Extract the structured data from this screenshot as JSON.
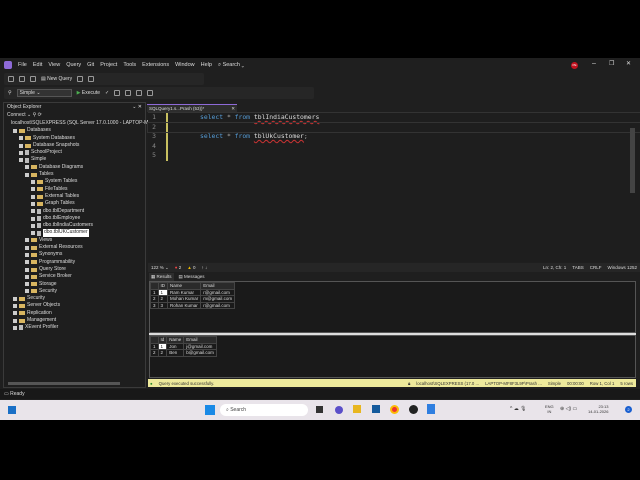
{
  "menu": [
    "File",
    "Edit",
    "View",
    "Query",
    "Git",
    "Project",
    "Tools",
    "Extensions",
    "Window",
    "Help"
  ],
  "search_label": "Search",
  "toolbar": {
    "new_query": "New Query",
    "database": "Simple",
    "execute": "Execute"
  },
  "avatar": "PE",
  "object_explorer": {
    "title": "Object Explorer",
    "connect": "Connect",
    "items": [
      {
        "label": "localhost\\SQLEXPRESS (SQL Server 17.0.1000 - LAPTOP-M",
        "level": 0,
        "type": "server"
      },
      {
        "label": "Databases",
        "level": 1,
        "type": "folder"
      },
      {
        "label": "System Databases",
        "level": 2,
        "type": "folder"
      },
      {
        "label": "Database Snapshots",
        "level": 2,
        "type": "folder"
      },
      {
        "label": "SchoolProject",
        "level": 2,
        "type": "db"
      },
      {
        "label": "Simple",
        "level": 2,
        "type": "db"
      },
      {
        "label": "Database Diagrams",
        "level": 3,
        "type": "folder"
      },
      {
        "label": "Tables",
        "level": 3,
        "type": "folder"
      },
      {
        "label": "System Tables",
        "level": 4,
        "type": "folder"
      },
      {
        "label": "FileTables",
        "level": 4,
        "type": "folder"
      },
      {
        "label": "External Tables",
        "level": 4,
        "type": "folder"
      },
      {
        "label": "Graph Tables",
        "level": 4,
        "type": "folder"
      },
      {
        "label": "dbo.tblDepartment",
        "level": 4,
        "type": "table"
      },
      {
        "label": "dbo.tblEmployee",
        "level": 4,
        "type": "table"
      },
      {
        "label": "dbo.tblIndiaCustomers",
        "level": 4,
        "type": "table"
      },
      {
        "label": "dbo.tblUKCustomer",
        "level": 4,
        "type": "table",
        "selected": true
      },
      {
        "label": "Views",
        "level": 3,
        "type": "folder"
      },
      {
        "label": "External Resources",
        "level": 3,
        "type": "folder"
      },
      {
        "label": "Synonyms",
        "level": 3,
        "type": "folder"
      },
      {
        "label": "Programmability",
        "level": 3,
        "type": "folder"
      },
      {
        "label": "Query Store",
        "level": 3,
        "type": "folder"
      },
      {
        "label": "Service Broker",
        "level": 3,
        "type": "folder"
      },
      {
        "label": "Storage",
        "level": 3,
        "type": "folder"
      },
      {
        "label": "Security",
        "level": 3,
        "type": "folder"
      },
      {
        "label": "Security",
        "level": 1,
        "type": "folder"
      },
      {
        "label": "Server Objects",
        "level": 1,
        "type": "folder"
      },
      {
        "label": "Replication",
        "level": 1,
        "type": "folder"
      },
      {
        "label": "Management",
        "level": 1,
        "type": "folder"
      },
      {
        "label": "XEvent Profiler",
        "level": 1,
        "type": "xe"
      }
    ]
  },
  "editor": {
    "tab": "SQLQuery1.s...Prash (53))*",
    "lines": [
      {
        "n": "1",
        "kw1": "select",
        "star": " * ",
        "kw2": "from",
        "ident": "tblIndiaCustomers",
        "end": ""
      },
      {
        "n": "2"
      },
      {
        "n": "3",
        "kw1": "select",
        "star": " * ",
        "kw2": "from",
        "ident": "tblUkCustomer",
        "end": ";"
      },
      {
        "n": "4"
      },
      {
        "n": "5"
      }
    ]
  },
  "results_bar": {
    "zoom": "122 %",
    "errors": "2",
    "warnings": "0",
    "position": "Ln: 2, Ch: 1",
    "tabs": "TABS",
    "eol": "CRLF",
    "encoding": "Windows 1252"
  },
  "results": {
    "tab_results": "Results",
    "tab_messages": "Messages",
    "grid1": {
      "headers": [
        "",
        "ID",
        "Name",
        "Email"
      ],
      "rows": [
        [
          "1",
          "1",
          "Ram Kumar",
          "r@gmail.com"
        ],
        [
          "2",
          "2",
          "Mohan Kumar",
          "m@gmail.com"
        ],
        [
          "3",
          "3",
          "Rohan Kumar",
          "r@gmail.com"
        ]
      ]
    },
    "grid2": {
      "headers": [
        "",
        "Id",
        "Name",
        "Email"
      ],
      "rows": [
        [
          "1",
          "1",
          "Jon",
          "j@gmail.com"
        ],
        [
          "2",
          "2",
          "Ben",
          "b@gmail.com"
        ]
      ]
    }
  },
  "query_status": {
    "message": "Query executed successfully.",
    "server": "localhost\\SQLEXPRESS (17.0 ...",
    "user": "LAPTOP-MF8F3L9P\\Prash ...",
    "db": "Simple",
    "time": "00:00:00",
    "rowcol": "Row 1, Col 1",
    "rows": "5 rows"
  },
  "status": "Ready",
  "taskbar": {
    "search": "Search",
    "lang": "ENG",
    "region": "IN",
    "time": "23:13",
    "date": "14-01-2026",
    "badge": "2"
  }
}
